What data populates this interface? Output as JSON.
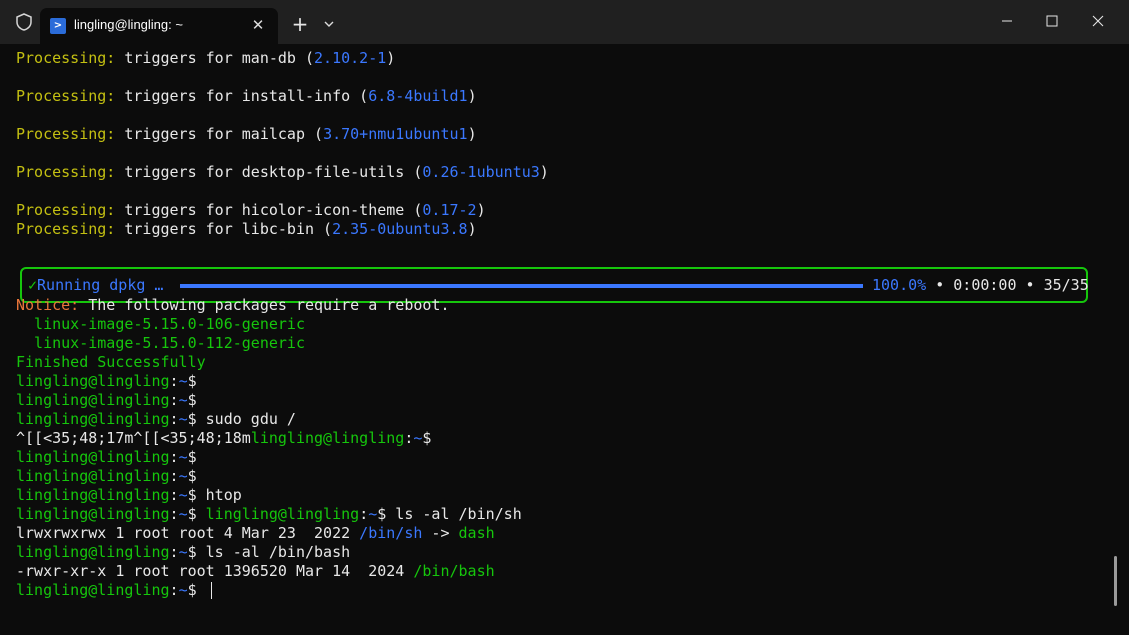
{
  "window": {
    "tab_title": "lingling@lingling: ~",
    "tab_icon": "powershell-icon",
    "close_tab_glyph": "✕",
    "new_tab_glyph": "+",
    "controls": [
      "minimize-icon",
      "maximize-icon",
      "close-icon"
    ]
  },
  "terminal": {
    "lines": [
      [
        {
          "t": "Processing:",
          "c": "yellow"
        },
        {
          "t": " triggers for man-db (",
          "c": "white"
        },
        {
          "t": "2.10.2-1",
          "c": "blue"
        },
        {
          "t": ")",
          "c": "white"
        }
      ],
      [],
      [
        {
          "t": "Processing:",
          "c": "yellow"
        },
        {
          "t": " triggers for install-info (",
          "c": "white"
        },
        {
          "t": "6.8-4build1",
          "c": "blue"
        },
        {
          "t": ")",
          "c": "white"
        }
      ],
      [],
      [
        {
          "t": "Processing:",
          "c": "yellow"
        },
        {
          "t": " triggers for mailcap (",
          "c": "white"
        },
        {
          "t": "3.70+nmu1ubuntu1",
          "c": "blue"
        },
        {
          "t": ")",
          "c": "white"
        }
      ],
      [],
      [
        {
          "t": "Processing:",
          "c": "yellow"
        },
        {
          "t": " triggers for desktop-file-utils (",
          "c": "white"
        },
        {
          "t": "0.26-1ubuntu3",
          "c": "blue"
        },
        {
          "t": ")",
          "c": "white"
        }
      ],
      [],
      [
        {
          "t": "Processing:",
          "c": "yellow"
        },
        {
          "t": " triggers for hicolor-icon-theme (",
          "c": "white"
        },
        {
          "t": "0.17-2",
          "c": "blue"
        },
        {
          "t": ")",
          "c": "white"
        }
      ],
      [
        {
          "t": "Processing:",
          "c": "yellow"
        },
        {
          "t": " triggers for libc-bin (",
          "c": "white"
        },
        {
          "t": "2.35-0ubuntu3.8",
          "c": "blue"
        },
        {
          "t": ")",
          "c": "white"
        }
      ],
      [],
      [],
      [],
      [
        {
          "t": "Notice:",
          "c": "orange"
        },
        {
          "t": " The following packages require a reboot.",
          "c": "white"
        }
      ],
      [
        {
          "t": "  linux-image-5.15.0-106-generic",
          "c": "green"
        }
      ],
      [
        {
          "t": "  linux-image-5.15.0-112-generic",
          "c": "green"
        }
      ],
      [
        {
          "t": "Finished Successfully",
          "c": "green"
        }
      ],
      [
        {
          "t": "lingling@lingling",
          "c": "green"
        },
        {
          "t": ":",
          "c": "white"
        },
        {
          "t": "~",
          "c": "blue"
        },
        {
          "t": "$",
          "c": "white"
        }
      ],
      [
        {
          "t": "lingling@lingling",
          "c": "green"
        },
        {
          "t": ":",
          "c": "white"
        },
        {
          "t": "~",
          "c": "blue"
        },
        {
          "t": "$",
          "c": "white"
        }
      ],
      [
        {
          "t": "lingling@lingling",
          "c": "green"
        },
        {
          "t": ":",
          "c": "white"
        },
        {
          "t": "~",
          "c": "blue"
        },
        {
          "t": "$ sudo gdu /",
          "c": "white"
        }
      ],
      [
        {
          "t": "^[[<35;48;17m^[[<35;48;18m",
          "c": "white"
        },
        {
          "t": "lingling@lingling",
          "c": "green"
        },
        {
          "t": ":",
          "c": "white"
        },
        {
          "t": "~",
          "c": "blue"
        },
        {
          "t": "$",
          "c": "white"
        }
      ],
      [
        {
          "t": "lingling@lingling",
          "c": "green"
        },
        {
          "t": ":",
          "c": "white"
        },
        {
          "t": "~",
          "c": "blue"
        },
        {
          "t": "$",
          "c": "white"
        }
      ],
      [
        {
          "t": "lingling@lingling",
          "c": "green"
        },
        {
          "t": ":",
          "c": "white"
        },
        {
          "t": "~",
          "c": "blue"
        },
        {
          "t": "$",
          "c": "white"
        }
      ],
      [
        {
          "t": "lingling@lingling",
          "c": "green"
        },
        {
          "t": ":",
          "c": "white"
        },
        {
          "t": "~",
          "c": "blue"
        },
        {
          "t": "$ htop",
          "c": "white"
        }
      ],
      [
        {
          "t": "lingling@lingling",
          "c": "green"
        },
        {
          "t": ":",
          "c": "white"
        },
        {
          "t": "~",
          "c": "blue"
        },
        {
          "t": "$ ",
          "c": "white"
        },
        {
          "t": "lingling@lingling",
          "c": "green"
        },
        {
          "t": ":",
          "c": "white"
        },
        {
          "t": "~",
          "c": "blue"
        },
        {
          "t": "$ ls -al /bin/sh",
          "c": "white"
        }
      ],
      [
        {
          "t": "lrwxrwxrwx 1 root root 4 Mar 23  2022 ",
          "c": "white"
        },
        {
          "t": "/bin/sh",
          "c": "blue"
        },
        {
          "t": " -> ",
          "c": "white"
        },
        {
          "t": "dash",
          "c": "green"
        }
      ],
      [
        {
          "t": "lingling@lingling",
          "c": "green"
        },
        {
          "t": ":",
          "c": "white"
        },
        {
          "t": "~",
          "c": "blue"
        },
        {
          "t": "$ ls -al /bin/bash",
          "c": "white"
        }
      ],
      [
        {
          "t": "-rwxr-xr-x 1 root root 1396520 Mar 14  2024 ",
          "c": "white"
        },
        {
          "t": "/bin/bash",
          "c": "green"
        }
      ],
      [
        {
          "t": "lingling@lingling",
          "c": "green"
        },
        {
          "t": ":",
          "c": "white"
        },
        {
          "t": "~",
          "c": "blue"
        },
        {
          "t": "$ ",
          "c": "white"
        }
      ]
    ],
    "progress": {
      "check_glyph": "✓",
      "label": "Running dpkg …",
      "fraction": 1.0,
      "percent_text": "100.0%",
      "separator": " • ",
      "elapsed": "0:00:00",
      "count": "35/35"
    }
  },
  "colors": {
    "background": "#0c0c0c",
    "yellow": "#c4c012",
    "blue": "#3b78ff",
    "green": "#16c60c",
    "orange": "#e8753a",
    "white": "#e8e8e8"
  }
}
